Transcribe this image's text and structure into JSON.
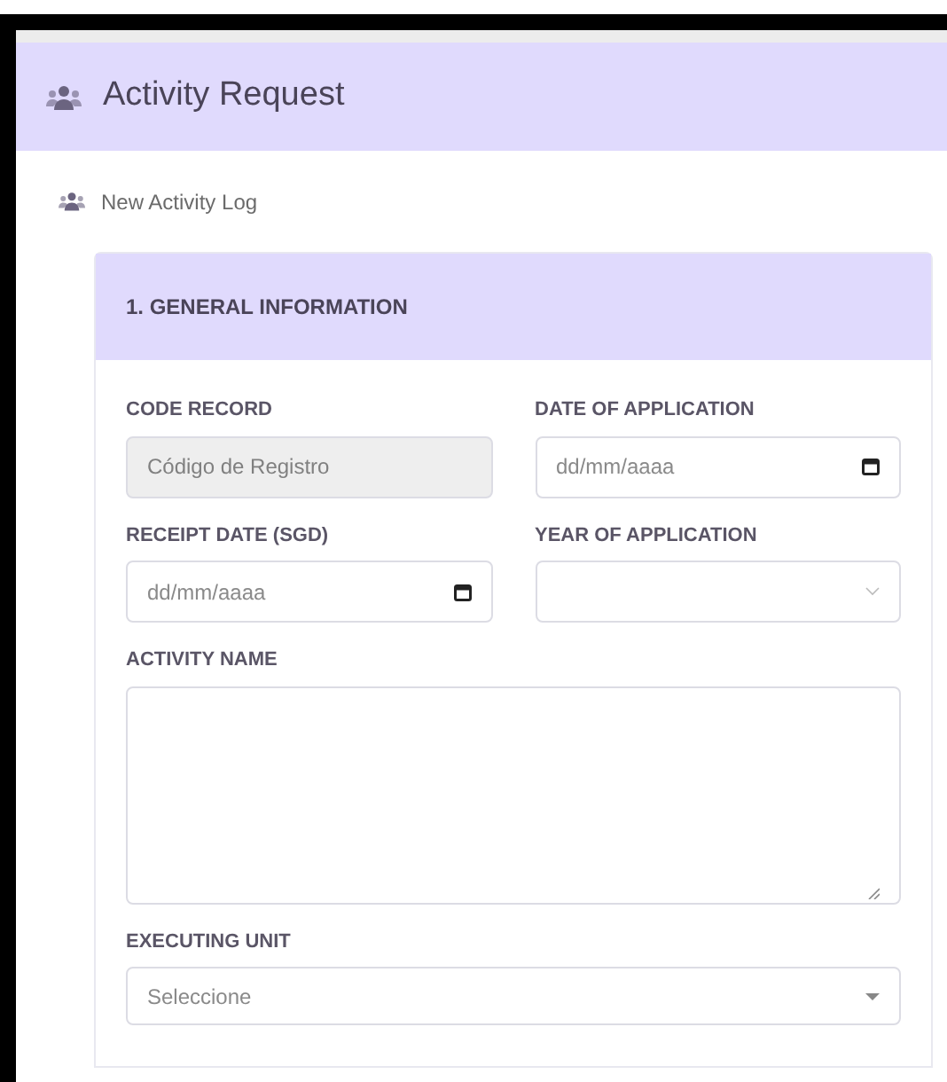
{
  "page_header": {
    "title": "Activity Request"
  },
  "subheading": "New Activity Log",
  "section": {
    "title": "1. GENERAL INFORMATION",
    "fields": [
      {
        "kind": "text",
        "label": "CODE RECORD",
        "placeholder": "Código de Registro",
        "disabled": true
      },
      {
        "kind": "date",
        "label": "DATE OF APPLICATION",
        "placeholder": "dd/mm/aaaa",
        "disabled": false
      },
      {
        "kind": "date",
        "label": "RECEIPT DATE (SGD)",
        "placeholder": "dd/mm/aaaa",
        "disabled": false
      },
      {
        "kind": "select",
        "label": "YEAR OF APPLICATION",
        "disabled": false
      },
      {
        "kind": "textarea",
        "label": "ACTIVITY NAME",
        "disabled": false
      },
      {
        "kind": "dropdown",
        "label": "EXECUTING UNIT",
        "placeholder": "Seleccione",
        "disabled": false
      }
    ]
  }
}
